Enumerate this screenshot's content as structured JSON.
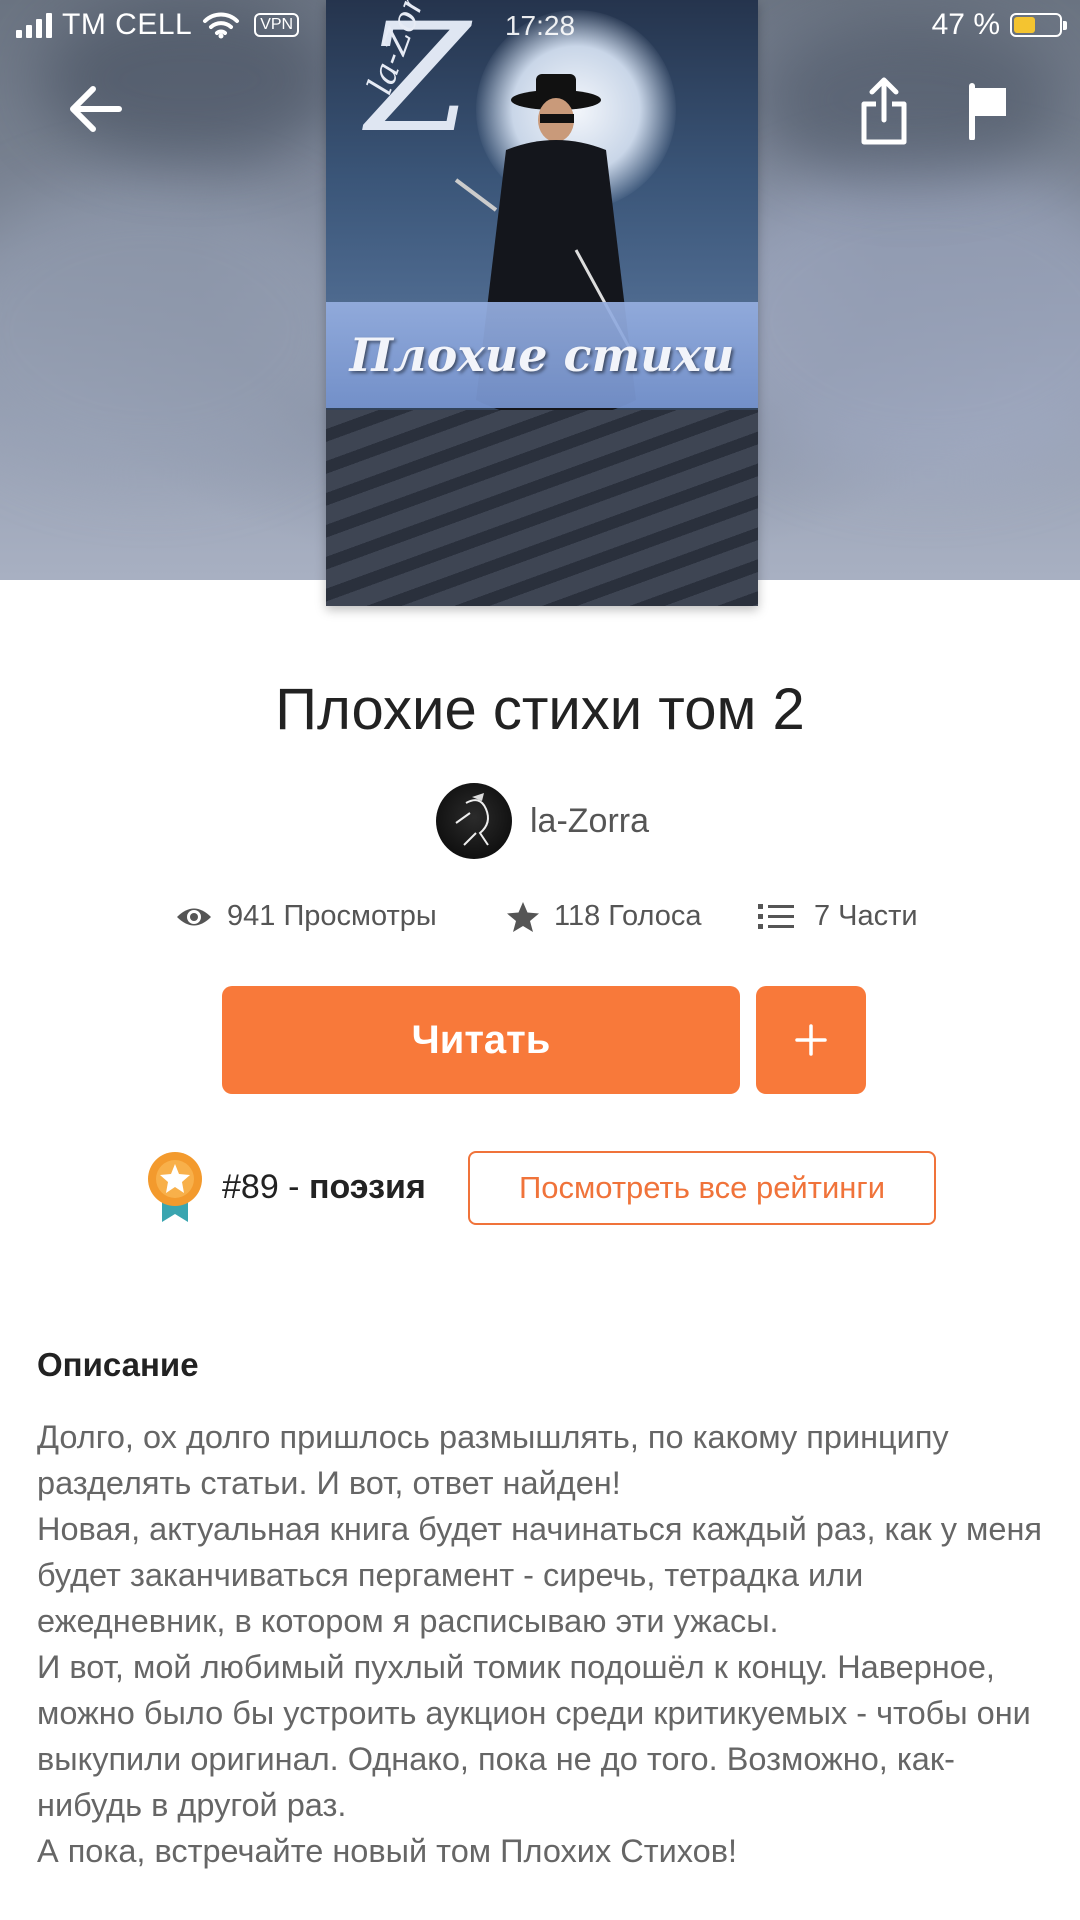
{
  "status_bar": {
    "carrier": "TM CELL",
    "vpn": "VPN",
    "time": "17:28",
    "battery": "47 %",
    "battery_level": 0.47
  },
  "nav": {
    "back_icon": "arrow-left-icon",
    "share_icon": "share-icon",
    "flag_icon": "flag-icon"
  },
  "cover": {
    "title_text": "Плохие стихи",
    "letter": "Z",
    "signature": "la-Zorra"
  },
  "story": {
    "title": "Плохие стихи том 2",
    "author": "la-Zorra"
  },
  "stats": {
    "views": "941 Просмотры",
    "votes": "118 Голоса",
    "parts": "7 Части"
  },
  "actions": {
    "read_label": "Читать",
    "add_label": "+"
  },
  "ranking": {
    "position": "#89",
    "separator": " - ",
    "category": "поэзия",
    "all_ratings_label": "Посмотреть все рейтинги"
  },
  "description": {
    "heading": "Описание",
    "text": "Долго, ох долго пришлось размышлять, по какому принципу разделять статьи. И вот, ответ найден!\nНовая, актуальная книга будет начинаться каждый раз, как у меня будет заканчиваться пергамент - сиречь, тетрадка или ежедневник, в котором я расписываю эти ужасы.\nИ вот, мой любимый пухлый томик подошёл к концу. Наверное, можно было бы устроить аукцион среди критикуемых - чтобы они выкупили оригинал. Однако, пока не до того. Возможно, как-нибудь в другой раз.\nА пока, встречайте новый том Плохих Стихов!"
  },
  "colors": {
    "accent": "#f8793a",
    "badge_orange": "#f39a2d",
    "badge_teal": "#3aa5b0"
  }
}
